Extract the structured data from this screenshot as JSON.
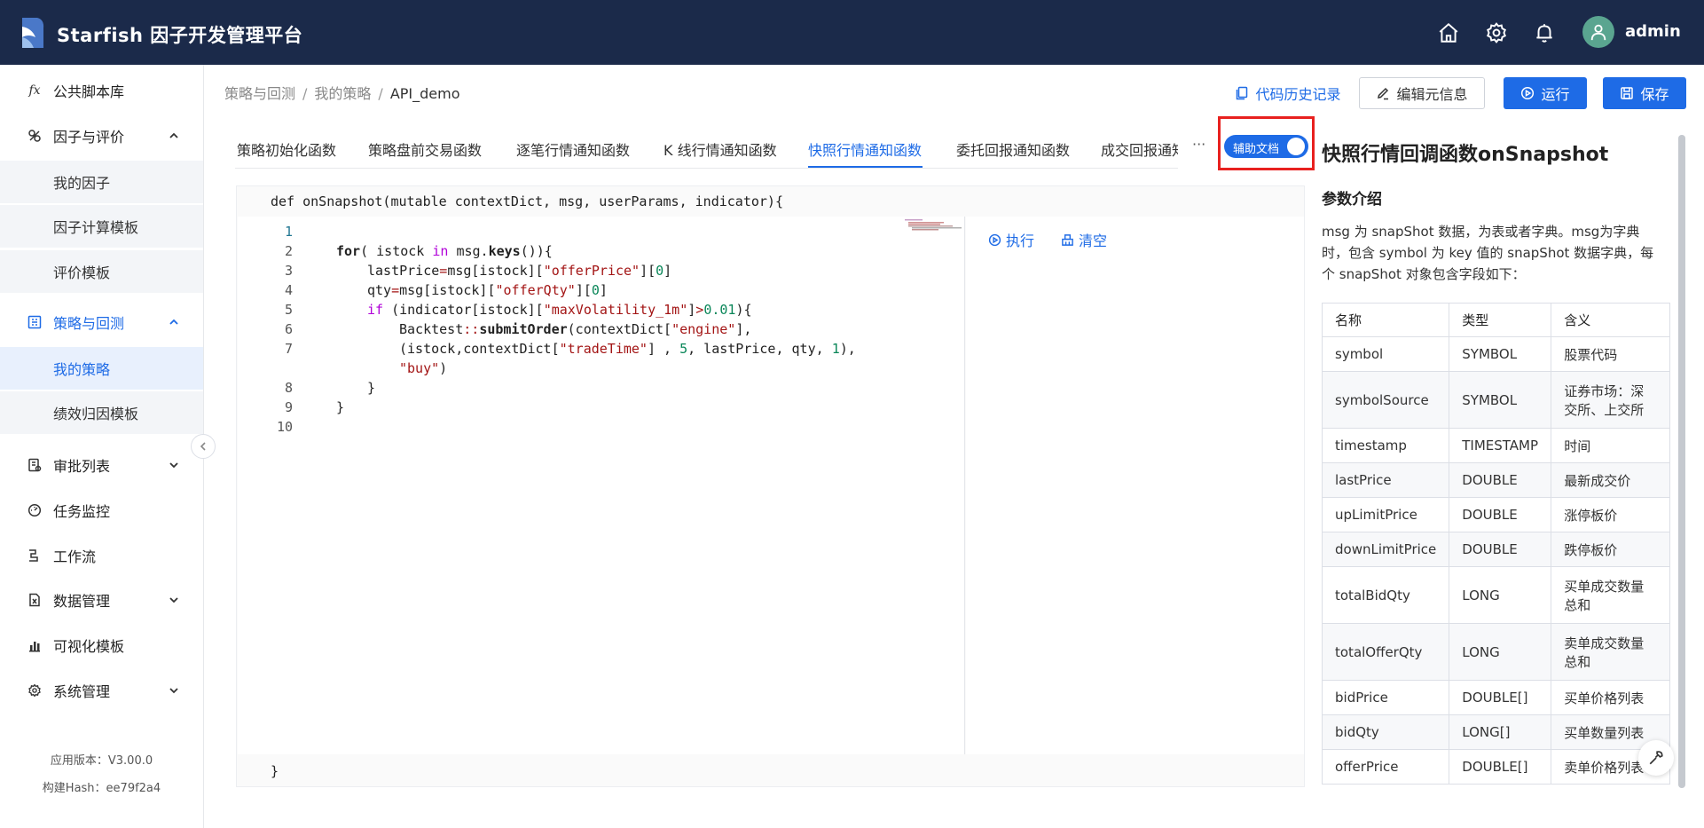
{
  "header": {
    "title": "Starfish 因子开发管理平台",
    "user": "admin",
    "icons": [
      "home-icon",
      "gear-icon",
      "bell-icon",
      "avatar"
    ]
  },
  "sidebar": {
    "items": [
      {
        "label": "公共脚本库",
        "icon": "fx-icon"
      },
      {
        "label": "因子与评价",
        "icon": "factor-icon",
        "expanded": true
      },
      {
        "label": "我的因子"
      },
      {
        "label": "因子计算模板"
      },
      {
        "label": "评价模板"
      },
      {
        "label": "策略与回测",
        "icon": "strategy-icon",
        "expanded": true,
        "active": true
      },
      {
        "label": "我的策略",
        "selected": true
      },
      {
        "label": "绩效归因模板"
      },
      {
        "label": "审批列表",
        "icon": "approval-icon"
      },
      {
        "label": "任务监控",
        "icon": "monitor-icon"
      },
      {
        "label": "工作流",
        "icon": "workflow-icon"
      },
      {
        "label": "数据管理",
        "icon": "data-icon"
      },
      {
        "label": "可视化模板",
        "icon": "chart-icon"
      },
      {
        "label": "系统管理",
        "icon": "system-gear-icon"
      }
    ],
    "version": "应用版本：V3.00.0",
    "build_hash": "构建Hash：ee79f2a4"
  },
  "breadcrumb": {
    "items": [
      "策略与回测",
      "我的策略",
      "API_demo"
    ],
    "sep": "/"
  },
  "toolbar": {
    "history_label": "代码历史记录",
    "edit_meta_label": "编辑元信息",
    "run_label": "运行",
    "save_label": "保存"
  },
  "tabs": {
    "items": [
      "策略初始化函数",
      "策略盘前交易函数",
      "逐笔行情通知函数",
      "K 线行情通知函数",
      "快照行情通知函数",
      "委托回报通知函数",
      "成交回报通知函数"
    ],
    "active_index": 4,
    "more": "···"
  },
  "toggle": {
    "label": "辅助文档",
    "on": true
  },
  "editor": {
    "signature": "def onSnapshot(mutable contextDict, msg, userParams, indicator){",
    "closing": "}",
    "line_numbers": [
      "1",
      "2",
      "3",
      "4",
      "5",
      "6",
      "7",
      "",
      "8",
      "9",
      "10"
    ],
    "exec_label": "执行",
    "clear_label": "清空"
  },
  "doc": {
    "title": "快照行情回调函数onSnapshot",
    "section": "参数介绍",
    "description": "msg 为 snapShot 数据，为表或者字典。msg为字典时，包含 symbol 为 key 值的 snapShot 数据字典，每个 snapShot 对象包含字段如下：",
    "columns": [
      "名称",
      "类型",
      "含义"
    ],
    "rows": [
      [
        "symbol",
        "SYMBOL",
        "股票代码"
      ],
      [
        "symbolSource",
        "SYMBOL",
        "证券市场：深交所、上交所"
      ],
      [
        "timestamp",
        "TIMESTAMP",
        "时间"
      ],
      [
        "lastPrice",
        "DOUBLE",
        "最新成交价"
      ],
      [
        "upLimitPrice",
        "DOUBLE",
        "涨停板价"
      ],
      [
        "downLimitPrice",
        "DOUBLE",
        "跌停板价"
      ],
      [
        "totalBidQty",
        "LONG",
        "买单成交数量总和"
      ],
      [
        "totalOfferQty",
        "LONG",
        "卖单成交数量总和"
      ],
      [
        "bidPrice",
        "DOUBLE[]",
        "买单价格列表"
      ],
      [
        "bidQty",
        "LONG[]",
        "买单数量列表"
      ],
      [
        "offerPrice",
        "DOUBLE[]",
        "卖单价格列表"
      ]
    ]
  },
  "colors": {
    "header_bg": "#1b2a4a",
    "accent": "#1e6be6",
    "highlight_box": "#e8211f"
  }
}
